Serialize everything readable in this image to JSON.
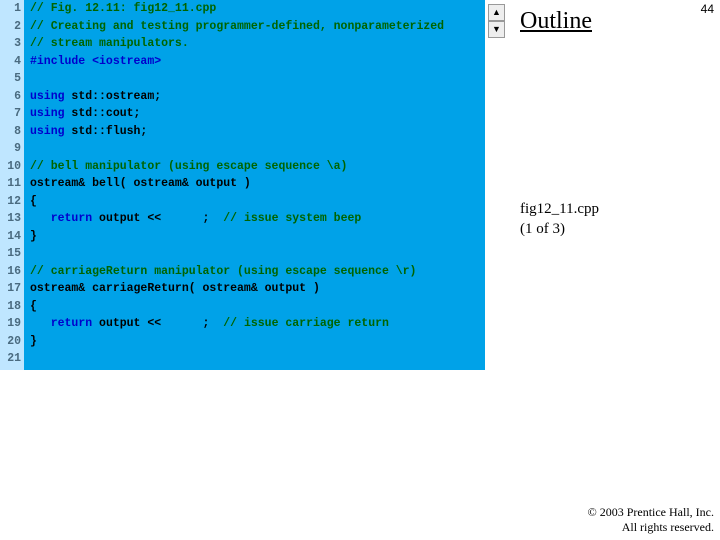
{
  "slide": {
    "number": "44",
    "outline_title": "Outline",
    "filename_line1": "fig12_11.cpp",
    "filename_line2": "(1 of 3)",
    "copyright_line1": "© 2003 Prentice Hall, Inc.",
    "copyright_line2": "All rights reserved.",
    "scroll_up": "▲",
    "scroll_down": "▼"
  },
  "code": {
    "lines": [
      {
        "n": "1",
        "spans": [
          [
            "cmt",
            "// Fig. 12.11: fig12_11.cpp"
          ]
        ]
      },
      {
        "n": "2",
        "spans": [
          [
            "cmt",
            "// Creating and testing programmer-defined, nonparameterized"
          ]
        ]
      },
      {
        "n": "3",
        "spans": [
          [
            "cmt",
            "// stream manipulators."
          ]
        ]
      },
      {
        "n": "4",
        "spans": [
          [
            "pp",
            "#include "
          ],
          [
            "kw",
            "<iostream>"
          ]
        ]
      },
      {
        "n": "5",
        "spans": []
      },
      {
        "n": "6",
        "spans": [
          [
            "kw",
            "using"
          ],
          [
            "s",
            " std::ostream;"
          ]
        ]
      },
      {
        "n": "7",
        "spans": [
          [
            "kw",
            "using"
          ],
          [
            "s",
            " std::cout;"
          ]
        ]
      },
      {
        "n": "8",
        "spans": [
          [
            "kw",
            "using"
          ],
          [
            "s",
            " std::flush;"
          ]
        ]
      },
      {
        "n": "9",
        "spans": []
      },
      {
        "n": "10",
        "spans": [
          [
            "cmt",
            "// bell manipulator (using escape sequence \\a)"
          ]
        ]
      },
      {
        "n": "11",
        "spans": [
          [
            "s",
            "ostream& bell( ostream& output )"
          ]
        ]
      },
      {
        "n": "12",
        "spans": [
          [
            "s",
            "{"
          ]
        ]
      },
      {
        "n": "13",
        "spans": [
          [
            "s",
            "   "
          ],
          [
            "kw",
            "return"
          ],
          [
            "s",
            " output <<      ;  "
          ],
          [
            "cmt",
            "// issue system beep"
          ]
        ]
      },
      {
        "n": "14",
        "spans": [
          [
            "s",
            "}"
          ]
        ]
      },
      {
        "n": "15",
        "spans": []
      },
      {
        "n": "16",
        "spans": [
          [
            "cmt",
            "// carriageReturn manipulator (using escape sequence \\r)"
          ]
        ]
      },
      {
        "n": "17",
        "spans": [
          [
            "s",
            "ostream& carriageReturn( ostream& output )"
          ]
        ]
      },
      {
        "n": "18",
        "spans": [
          [
            "s",
            "{"
          ]
        ]
      },
      {
        "n": "19",
        "spans": [
          [
            "s",
            "   "
          ],
          [
            "kw",
            "return"
          ],
          [
            "s",
            " output <<      ;  "
          ],
          [
            "cmt",
            "// issue carriage return"
          ]
        ]
      },
      {
        "n": "20",
        "spans": [
          [
            "s",
            "}"
          ]
        ]
      },
      {
        "n": "21",
        "spans": []
      }
    ]
  }
}
